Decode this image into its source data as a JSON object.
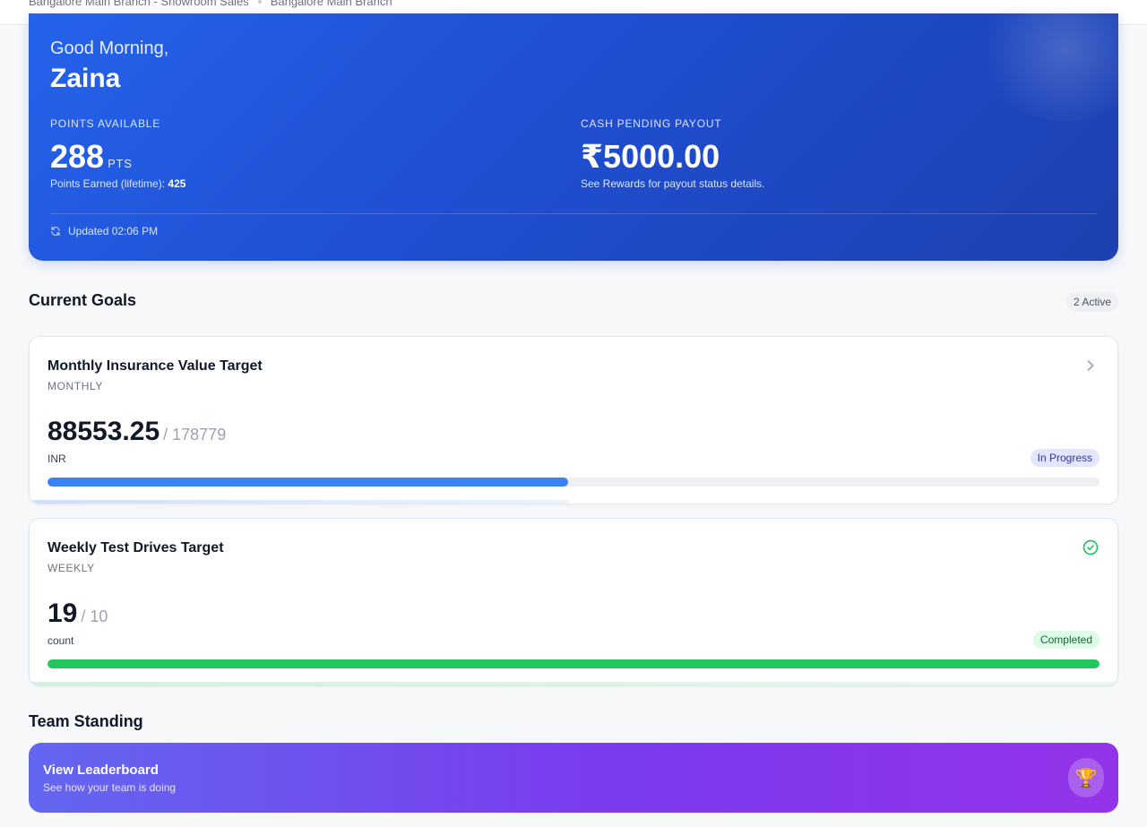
{
  "breadcrumb": {
    "items": [
      "Bangalore Main Branch - Showroom Sales",
      "Bangalore Main Branch"
    ]
  },
  "hero": {
    "greeting": "Good Morning,",
    "name": "Zaina",
    "points": {
      "label": "POINTS AVAILABLE",
      "value": "288",
      "unit": "PTS",
      "sub_prefix": "Points Earned (lifetime): ",
      "sub_value": "425"
    },
    "cash": {
      "label": "CASH PENDING PAYOUT",
      "value": "₹5000.00",
      "sub": "See Rewards for payout status details."
    },
    "updated": "Updated 02:06 PM",
    "updated_icon": "refresh-icon"
  },
  "goals": {
    "title": "Current Goals",
    "active_count": "2 Active",
    "items": [
      {
        "name": "Monthly Insurance Value Target",
        "period": "MONTHLY",
        "value": "88553.25",
        "target": "/ 178779",
        "unit": "INR",
        "status": "In Progress",
        "progress": 0.495,
        "icon": "chevron-right-icon",
        "color": "#3b82f6"
      },
      {
        "name": "Weekly Test Drives Target",
        "period": "WEEKLY",
        "value": "19",
        "target": "/ 10",
        "unit": "count",
        "status": "Completed",
        "progress": 1.0,
        "icon": "check-circle-icon",
        "color": "#22c55e"
      }
    ]
  },
  "team": {
    "title": "Team Standing",
    "leaderboard_title": "View Leaderboard",
    "leaderboard_sub": "See how your team is doing",
    "icon": "trophy-icon"
  }
}
